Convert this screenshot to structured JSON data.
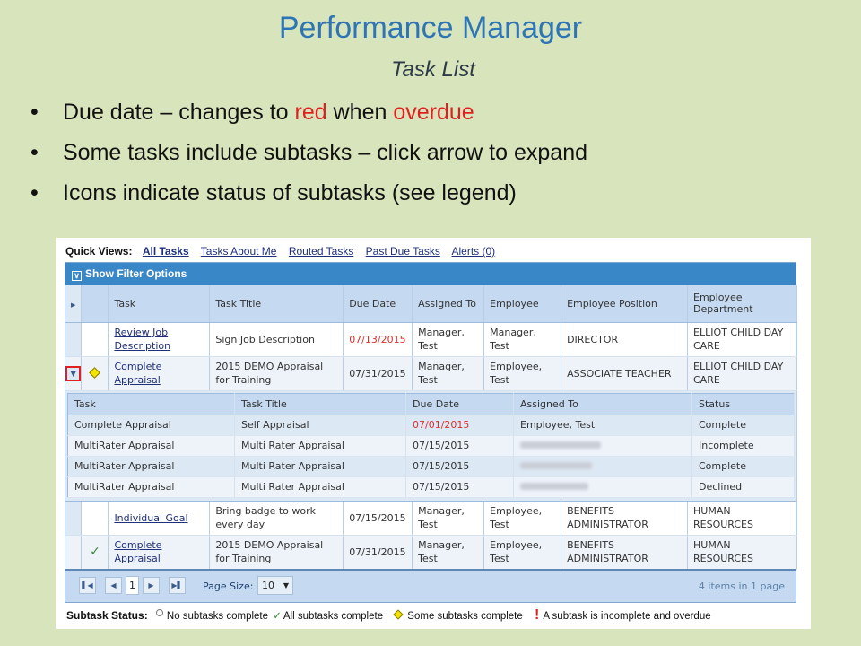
{
  "slide": {
    "title": "Performance Manager",
    "subtitle": "Task List",
    "bullets": [
      {
        "parts": [
          {
            "t": "Due date – changes to ",
            "red": false
          },
          {
            "t": "red",
            "red": true
          },
          {
            "t": " when ",
            "red": false
          },
          {
            "t": "overdue",
            "red": true
          }
        ]
      },
      {
        "parts": [
          {
            "t": "Some tasks include subtasks – click arrow to expand",
            "red": false
          }
        ]
      },
      {
        "parts": [
          {
            "t": "Icons indicate status of subtasks (see legend)",
            "red": false
          }
        ]
      }
    ]
  },
  "quick_views": {
    "label": "Quick Views:",
    "links": [
      "All Tasks",
      "Tasks About Me",
      "Routed Tasks",
      "Past Due Tasks",
      "Alerts (0)"
    ],
    "active": "All Tasks"
  },
  "filter": {
    "label": "Show Filter Options",
    "icon": "double-chevron-down-icon"
  },
  "task_table": {
    "columns": [
      "Task",
      "Task Title",
      "Due Date",
      "Assigned To",
      "Employee",
      "Employee Position",
      "Employee Department"
    ],
    "rows": [
      {
        "status_icon": "",
        "expandable": false,
        "task": "Review Job Description",
        "title": "Sign Job Description",
        "due": "07/13/2015",
        "overdue": true,
        "assigned": "Manager, Test",
        "employee": "Manager, Test",
        "position": "DIRECTOR",
        "department": "ELLIOT CHILD DAY CARE"
      },
      {
        "status_icon": "diamond",
        "expandable": true,
        "expanded": true,
        "task": "Complete Appraisal",
        "title": "2015 DEMO Appraisal for Training",
        "due": "07/31/2015",
        "overdue": false,
        "assigned": "Manager, Test",
        "employee": "Employee, Test",
        "position": "ASSOCIATE TEACHER",
        "department": "ELLIOT CHILD DAY CARE"
      },
      {
        "status_icon": "",
        "expandable": false,
        "task": "Individual Goal",
        "title": "Bring badge to work every day",
        "due": "07/15/2015",
        "overdue": false,
        "assigned": "Manager, Test",
        "employee": "Employee, Test",
        "position": "BENEFITS ADMINISTRATOR",
        "department": "HUMAN RESOURCES"
      },
      {
        "status_icon": "check",
        "expandable": false,
        "task": "Complete Appraisal",
        "title": "2015 DEMO Appraisal for Training",
        "due": "07/31/2015",
        "overdue": false,
        "assigned": "Manager, Test",
        "employee": "Employee, Test",
        "position": "BENEFITS ADMINISTRATOR",
        "department": "HUMAN RESOURCES"
      }
    ]
  },
  "subtask_table": {
    "columns": [
      "Task",
      "Task Title",
      "Due Date",
      "Assigned To",
      "Status"
    ],
    "rows": [
      {
        "task": "Complete Appraisal",
        "title": "Self Appraisal",
        "due": "07/01/2015",
        "overdue": true,
        "assigned": "Employee, Test",
        "blurred": false,
        "status": "Complete"
      },
      {
        "task": "MultiRater Appraisal",
        "title": "Multi Rater Appraisal",
        "due": "07/15/2015",
        "overdue": false,
        "assigned": "",
        "blurred": true,
        "status": "Incomplete"
      },
      {
        "task": "MultiRater Appraisal",
        "title": "Multi Rater Appraisal",
        "due": "07/15/2015",
        "overdue": false,
        "assigned": "",
        "blurred": true,
        "status": "Complete"
      },
      {
        "task": "MultiRater Appraisal",
        "title": "Multi Rater Appraisal",
        "due": "07/15/2015",
        "overdue": false,
        "assigned": "",
        "blurred": true,
        "status": "Declined"
      }
    ]
  },
  "pager": {
    "current_page": "1",
    "page_size_label": "Page Size:",
    "page_size": "10",
    "info": "4 items in 1 page"
  },
  "legend": {
    "label": "Subtask Status:",
    "items": [
      {
        "icon": "circle",
        "text": "No subtasks complete"
      },
      {
        "icon": "check",
        "text": "All subtasks complete"
      },
      {
        "icon": "diamond",
        "text": "Some subtasks complete"
      },
      {
        "icon": "exclamation",
        "text": "A subtask is incomplete and overdue"
      }
    ]
  },
  "colors": {
    "title": "#2e75b6",
    "overdue": "#d9302c",
    "header_bar": "#3a87c8",
    "background": "#d8e4bc"
  }
}
